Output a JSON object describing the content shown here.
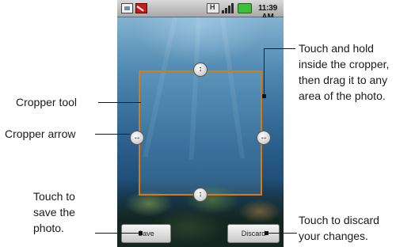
{
  "status_bar": {
    "time": "11:39 AM",
    "icons": [
      "photo-notification-icon",
      "mail-notification-icon",
      "network-icon",
      "signal-icon",
      "battery-icon"
    ],
    "battery_color": "#3cc03c"
  },
  "editor": {
    "cropper_border_color": "#d67a12",
    "handles": [
      "up-down-arrow-icon",
      "up-down-arrow-icon",
      "left-right-arrow-icon",
      "left-right-arrow-icon"
    ],
    "handle_glyph_vertical": "↕",
    "handle_glyph_horizontal": "↔",
    "save_label": "Save",
    "discard_label": "Discard"
  },
  "annotations": {
    "cropper_tool": "Cropper tool",
    "cropper_arrow": "Cropper arrow",
    "touch_hold_1": "Touch and hold",
    "touch_hold_2": "inside the cropper,",
    "touch_hold_3": "then drag it to any",
    "touch_hold_4": "area of the photo.",
    "save_1": "Touch to",
    "save_2": "save the",
    "save_3": "photo.",
    "discard_1": "Touch to discard",
    "discard_2": "your changes."
  }
}
